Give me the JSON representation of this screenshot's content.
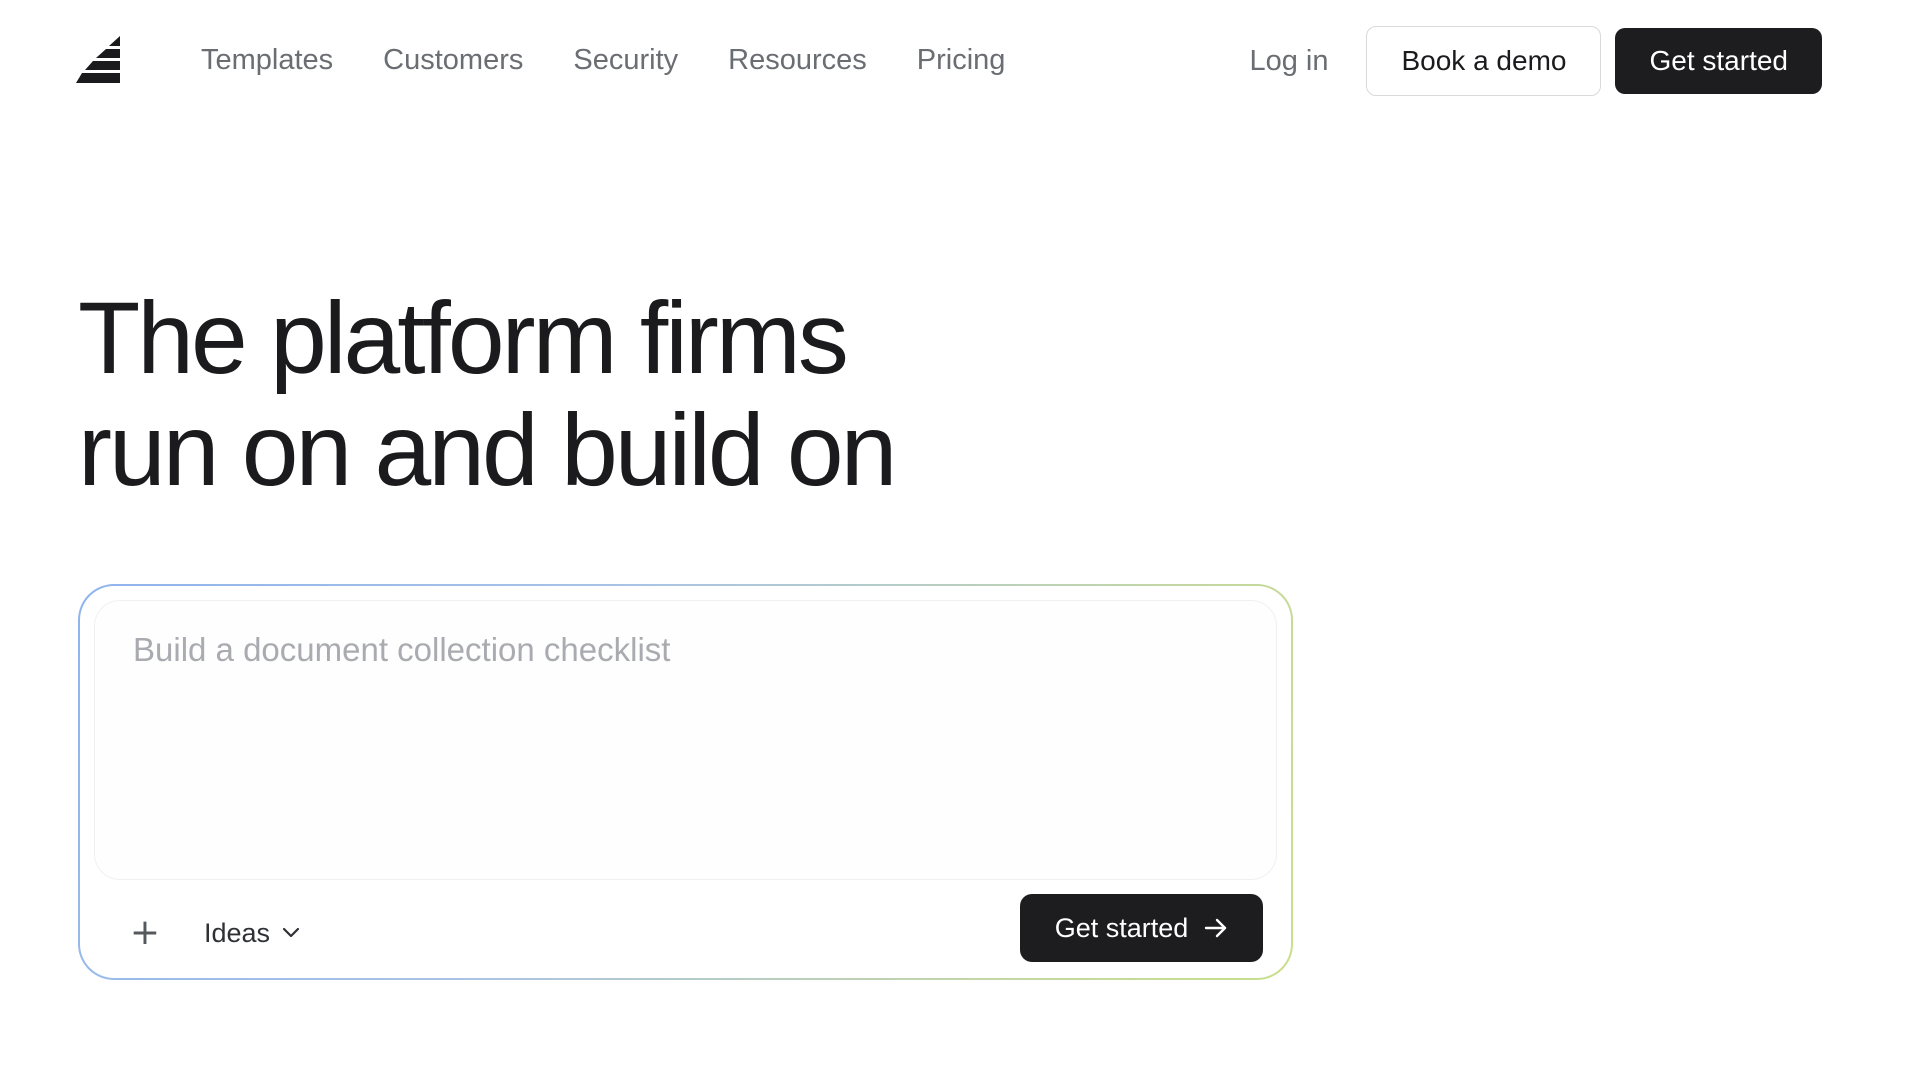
{
  "header": {
    "logo_icon": "stacked-stripes-logo-icon",
    "nav": [
      {
        "label": "Templates"
      },
      {
        "label": "Customers"
      },
      {
        "label": "Security"
      },
      {
        "label": "Resources"
      },
      {
        "label": "Pricing"
      }
    ],
    "login_label": "Log in",
    "book_demo_label": "Book a demo",
    "get_started_label": "Get started"
  },
  "hero": {
    "title_line1": "The platform firms",
    "title_line2": "run on and build on"
  },
  "prompt": {
    "value": "",
    "placeholder": "Build a document collection checklist",
    "attach_icon": "plus-icon",
    "ideas_label": "Ideas",
    "ideas_icon": "chevron-down-icon",
    "submit_label": "Get started",
    "submit_icon": "arrow-right-icon"
  },
  "colors": {
    "background": "#ffffff",
    "text_primary": "#1b1b1d",
    "text_muted": "#6a6d72",
    "button_dark": "#1d1d1f",
    "gradient_start": "#8fb4ec",
    "gradient_end": "#c9df8a"
  }
}
